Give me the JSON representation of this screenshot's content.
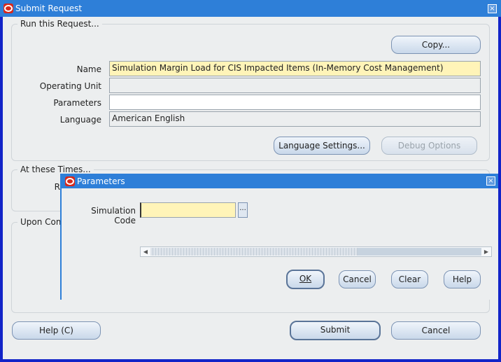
{
  "main_window": {
    "title": "Submit Request",
    "close": "×"
  },
  "run_request": {
    "group_label": "Run this Request...",
    "copy_button": "Copy...",
    "name_label": "Name",
    "name_value": "Simulation Margin Load for CIS Impacted Items (In-Memory Cost Management)",
    "operating_unit_label": "Operating Unit",
    "operating_unit_value": "",
    "parameters_label": "Parameters",
    "parameters_value": "",
    "language_label": "Language",
    "language_value": "American English",
    "language_settings_button": "Language Settings...",
    "debug_options_button": "Debug Options"
  },
  "at_these_times": {
    "group_label": "At these Times...",
    "partial_label": "R"
  },
  "upon_completion": {
    "group_label": "Upon Com"
  },
  "bottom_buttons": {
    "help": "Help (C)",
    "submit": "Submit",
    "cancel": "Cancel"
  },
  "parameters_dialog": {
    "title": "Parameters",
    "close": "×",
    "simulation_code_label": "Simulation Code",
    "simulation_code_value": "",
    "lov_button": "...",
    "ok_button": "OK",
    "cancel_button": "Cancel",
    "clear_button": "Clear",
    "help_button": "Help"
  },
  "colors": {
    "title_bar": "#2e7fd8",
    "window_border": "#1224c8",
    "required_field": "#fff4b8"
  }
}
